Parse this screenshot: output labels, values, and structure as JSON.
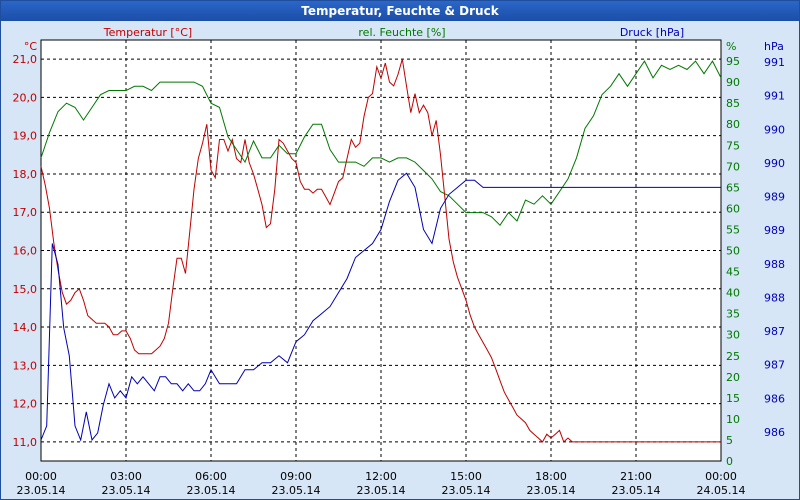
{
  "window": {
    "title": "Temperatur, Feuchte & Druck"
  },
  "colors": {
    "temperature": "#c00000",
    "humidity": "#007800",
    "pressure": "#0000b4",
    "grid": "#000000",
    "plot_bg": "#ffffff"
  },
  "chart_data": {
    "type": "line",
    "title": "Temperatur, Feuchte & Druck",
    "grid": true,
    "x_ticks": [
      {
        "time": "00:00",
        "date": "23.05.14"
      },
      {
        "time": "03:00",
        "date": "23.05.14"
      },
      {
        "time": "06:00",
        "date": "23.05.14"
      },
      {
        "time": "09:00",
        "date": "23.05.14"
      },
      {
        "time": "12:00",
        "date": "23.05.14"
      },
      {
        "time": "15:00",
        "date": "23.05.14"
      },
      {
        "time": "18:00",
        "date": "23.05.14"
      },
      {
        "time": "21:00",
        "date": "23.05.14"
      },
      {
        "time": "00:00",
        "date": "24.05.14"
      }
    ],
    "axes": {
      "temperature": {
        "label": "Temperatur [°C]",
        "unit": "°C",
        "ylim": [
          10.5,
          21.5
        ],
        "ticks": [
          "21,0",
          "20,0",
          "19,0",
          "18,0",
          "17,0",
          "16,0",
          "15,0",
          "14,0",
          "13,0",
          "12,0",
          "11,0"
        ]
      },
      "humidity": {
        "label": "rel. Feuchte [%]",
        "unit": "%",
        "ylim": [
          0,
          100
        ],
        "ticks": [
          "95",
          "90",
          "85",
          "80",
          "75",
          "70",
          "65",
          "60",
          "55",
          "50",
          "45",
          "40",
          "35",
          "30",
          "25",
          "20",
          "15",
          "10",
          "5",
          "0"
        ]
      },
      "pressure": {
        "label": "Druck [hPa]",
        "unit": "hPa",
        "ylim": [
          985.7,
          991.7
        ],
        "ticks": [
          "991",
          "991",
          "990",
          "990",
          "989",
          "989",
          "988",
          "988",
          "987",
          "987",
          "986",
          "986"
        ]
      }
    },
    "series": [
      {
        "name": "Temperatur [°C]",
        "axis": "temperature",
        "color": "#c00000",
        "x": [
          0,
          0.15,
          0.3,
          0.45,
          0.6,
          0.75,
          0.9,
          1.05,
          1.2,
          1.35,
          1.5,
          1.65,
          1.8,
          1.95,
          2.1,
          2.25,
          2.4,
          2.55,
          2.7,
          2.85,
          3.0,
          3.15,
          3.3,
          3.45,
          3.6,
          3.75,
          3.9,
          4.05,
          4.2,
          4.35,
          4.5,
          4.65,
          4.8,
          4.95,
          5.1,
          5.25,
          5.4,
          5.55,
          5.7,
          5.85,
          6.0,
          6.15,
          6.3,
          6.45,
          6.6,
          6.75,
          6.9,
          7.05,
          7.2,
          7.35,
          7.5,
          7.65,
          7.8,
          7.95,
          8.1,
          8.25,
          8.4,
          8.55,
          8.7,
          8.85,
          9.0,
          9.15,
          9.3,
          9.45,
          9.6,
          9.75,
          9.9,
          10.05,
          10.2,
          10.35,
          10.5,
          10.65,
          10.8,
          10.95,
          11.1,
          11.25,
          11.4,
          11.55,
          11.7,
          11.85,
          12.0,
          12.15,
          12.3,
          12.45,
          12.6,
          12.75,
          12.9,
          13.05,
          13.2,
          13.35,
          13.5,
          13.65,
          13.8,
          13.95,
          14.1,
          14.25,
          14.4,
          14.55,
          14.7,
          14.85,
          15.0,
          15.15,
          15.3,
          15.45,
          15.6,
          15.75,
          15.9,
          16.05,
          16.2,
          16.35,
          16.5,
          16.65,
          16.8,
          16.95,
          17.1,
          17.25,
          17.4,
          17.55,
          17.7,
          17.85,
          18.0,
          18.15,
          18.3,
          18.45,
          18.6,
          18.75,
          18.9,
          19.05,
          19.2,
          19.35,
          19.5,
          19.65,
          19.8,
          19.95,
          20.1,
          20.25,
          20.4,
          20.55,
          20.7,
          20.85,
          21.0,
          21.15,
          21.3,
          21.45,
          21.6,
          21.75,
          21.9,
          22.05,
          22.2,
          22.35,
          22.5,
          22.65,
          22.8,
          22.95,
          23.1,
          23.25,
          23.4,
          23.55,
          23.7,
          23.85,
          24.0
        ],
        "values": [
          18.2,
          17.7,
          17.1,
          16.2,
          15.5,
          14.9,
          14.6,
          14.7,
          14.9,
          15.0,
          14.7,
          14.3,
          14.2,
          14.1,
          14.1,
          14.1,
          14.0,
          13.8,
          13.8,
          13.9,
          13.9,
          13.7,
          13.4,
          13.3,
          13.3,
          13.3,
          13.3,
          13.4,
          13.5,
          13.7,
          14.1,
          15.0,
          15.8,
          15.8,
          15.4,
          16.5,
          17.6,
          18.4,
          18.8,
          19.3,
          18.1,
          17.9,
          18.9,
          18.9,
          18.6,
          18.9,
          18.4,
          18.3,
          18.9,
          18.3,
          18.0,
          17.6,
          17.2,
          16.6,
          16.7,
          17.6,
          18.9,
          18.8,
          18.6,
          18.4,
          18.3,
          17.8,
          17.6,
          17.6,
          17.5,
          17.6,
          17.6,
          17.4,
          17.2,
          17.5,
          17.8,
          17.9,
          18.4,
          18.9,
          18.7,
          18.8,
          19.5,
          20.0,
          20.1,
          20.8,
          20.5,
          20.9,
          20.4,
          20.3,
          20.6,
          21.0,
          20.3,
          19.6,
          20.1,
          19.6,
          19.8,
          19.6,
          19.0,
          19.4,
          18.5,
          17.4,
          16.3,
          15.7,
          15.3,
          15.0,
          14.7,
          14.3,
          14.0,
          13.8,
          13.6,
          13.4,
          13.2,
          12.9,
          12.6,
          12.3,
          12.1,
          11.9,
          11.7,
          11.6,
          11.5,
          11.3,
          11.2,
          11.1,
          11.0,
          11.2,
          11.1,
          11.2,
          11.3,
          11.0,
          11.1,
          11.0,
          11.0,
          11.0,
          11.0,
          11.0,
          11.0,
          11.0,
          11.0,
          11.0,
          11.0,
          11.0,
          11.0,
          11.0,
          11.0,
          11.0,
          11.0,
          11.0,
          11.0,
          11.0,
          11.0,
          11.0,
          11.0,
          11.0,
          11.0,
          11.0,
          11.0,
          11.0,
          11.0,
          11.0,
          11.0,
          11.0,
          11.0,
          11.0,
          11.0,
          11.0,
          11.0
        ]
      },
      {
        "name": "rel. Feuchte [%]",
        "axis": "humidity",
        "color": "#007800",
        "x": [
          0,
          0.3,
          0.6,
          0.9,
          1.2,
          1.5,
          1.8,
          2.1,
          2.4,
          2.7,
          3.0,
          3.3,
          3.6,
          3.9,
          4.2,
          4.5,
          4.8,
          5.1,
          5.4,
          5.7,
          6.0,
          6.3,
          6.6,
          6.9,
          7.2,
          7.5,
          7.8,
          8.1,
          8.4,
          8.7,
          9.0,
          9.3,
          9.6,
          9.9,
          10.2,
          10.5,
          10.8,
          11.1,
          11.4,
          11.7,
          12.0,
          12.3,
          12.6,
          12.9,
          13.2,
          13.5,
          13.8,
          14.1,
          14.4,
          14.7,
          15.0,
          15.3,
          15.6,
          15.9,
          16.2,
          16.5,
          16.8,
          17.1,
          17.4,
          17.7,
          18.0,
          18.3,
          18.6,
          18.9,
          19.2,
          19.5,
          19.8,
          20.1,
          20.4,
          20.7,
          21.0,
          21.3,
          21.6,
          21.9,
          22.2,
          22.5,
          22.8,
          23.1,
          23.4,
          23.7,
          24.0
        ],
        "values": [
          72,
          78,
          83,
          85,
          84,
          81,
          84,
          87,
          88,
          88,
          88,
          89,
          89,
          88,
          90,
          90,
          90,
          90,
          90,
          89,
          85,
          84,
          77,
          74,
          71,
          76,
          72,
          72,
          75,
          73,
          73,
          77,
          80,
          80,
          74,
          71,
          71,
          71,
          70,
          72,
          72,
          71,
          72,
          72,
          71,
          69,
          67,
          64,
          63,
          61,
          59,
          59,
          59,
          58,
          56,
          59,
          57,
          62,
          61,
          63,
          61,
          64,
          67,
          72,
          79,
          82,
          87,
          89,
          92,
          89,
          92,
          95,
          91,
          94,
          93,
          94,
          93,
          95,
          92,
          95,
          91
        ]
      },
      {
        "name": "Druck [hPa]",
        "axis": "pressure",
        "color": "#0000b4",
        "x": [
          0,
          0.2,
          0.4,
          0.6,
          0.8,
          1.0,
          1.2,
          1.4,
          1.6,
          1.8,
          2.0,
          2.2,
          2.4,
          2.6,
          2.8,
          3.0,
          3.2,
          3.4,
          3.6,
          3.8,
          4.0,
          4.2,
          4.4,
          4.6,
          4.8,
          5.0,
          5.2,
          5.4,
          5.6,
          5.8,
          6.0,
          6.3,
          6.6,
          6.9,
          7.2,
          7.5,
          7.8,
          8.1,
          8.4,
          8.7,
          9.0,
          9.3,
          9.6,
          9.9,
          10.2,
          10.5,
          10.8,
          11.1,
          11.4,
          11.7,
          12.0,
          12.3,
          12.6,
          12.9,
          13.2,
          13.5,
          13.8,
          14.1,
          14.4,
          14.7,
          15.0,
          15.3,
          15.6,
          15.9,
          16.2,
          16.5,
          16.8,
          17.1,
          17.4,
          17.7,
          18.0,
          18.3,
          18.6,
          18.9,
          19.2,
          19.5,
          19.8,
          20.1,
          20.4,
          20.7,
          21.0,
          21.3,
          21.6,
          21.9,
          22.2,
          22.5,
          22.8,
          23.1,
          23.4,
          23.7,
          24.0
        ],
        "values": [
          986.0,
          986.2,
          988.8,
          988.5,
          987.6,
          987.2,
          986.2,
          986.0,
          986.4,
          986.0,
          986.1,
          986.5,
          986.8,
          986.6,
          986.7,
          986.6,
          986.9,
          986.8,
          986.9,
          986.8,
          986.7,
          986.9,
          986.9,
          986.8,
          986.8,
          986.7,
          986.8,
          986.7,
          986.7,
          986.8,
          987.0,
          986.8,
          986.8,
          986.8,
          987.0,
          987.0,
          987.1,
          987.1,
          987.2,
          987.1,
          987.4,
          987.5,
          987.7,
          987.8,
          987.9,
          988.1,
          988.3,
          988.6,
          988.7,
          988.8,
          989.0,
          989.4,
          989.7,
          989.8,
          989.6,
          989.0,
          988.8,
          989.3,
          989.5,
          989.6,
          989.7,
          989.7,
          989.6,
          989.6,
          989.6,
          989.6,
          989.6,
          989.6,
          989.6,
          989.6,
          989.6,
          989.6,
          989.6,
          989.6,
          989.6,
          989.6,
          989.6,
          989.6,
          989.6,
          989.6,
          989.6,
          989.6,
          989.6,
          989.6,
          989.6,
          989.6,
          989.6,
          989.6,
          989.6,
          989.6,
          989.6
        ]
      }
    ]
  }
}
